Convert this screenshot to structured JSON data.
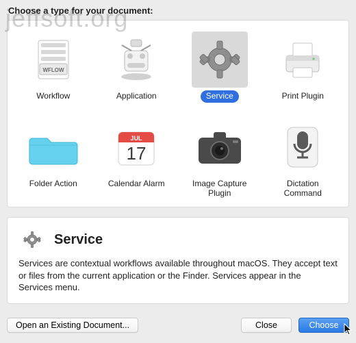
{
  "watermark": "jeffsoft.org",
  "heading": "Choose a type for your document:",
  "types": [
    {
      "id": "workflow",
      "label": "Workflow"
    },
    {
      "id": "application",
      "label": "Application"
    },
    {
      "id": "service",
      "label": "Service"
    },
    {
      "id": "print-plugin",
      "label": "Print Plugin"
    },
    {
      "id": "folder-action",
      "label": "Folder Action"
    },
    {
      "id": "calendar-alarm",
      "label": "Calendar Alarm"
    },
    {
      "id": "image-capture",
      "label": "Image Capture Plugin"
    },
    {
      "id": "dictation",
      "label": "Dictation Command"
    }
  ],
  "selected_type": "service",
  "detail": {
    "title": "Service",
    "description": "Services are contextual workflows available throughout macOS. They accept text or files from the current application or the Finder. Services appear in the Services menu."
  },
  "buttons": {
    "open_existing": "Open an Existing Document...",
    "close": "Close",
    "choose": "Choose"
  },
  "calendar_icon": {
    "month": "JUL",
    "day": "17"
  },
  "colors": {
    "selection_fill": "#2f6fe0",
    "primary_btn_top": "#5aa1f2",
    "primary_btn_bottom": "#2a7ae2"
  }
}
